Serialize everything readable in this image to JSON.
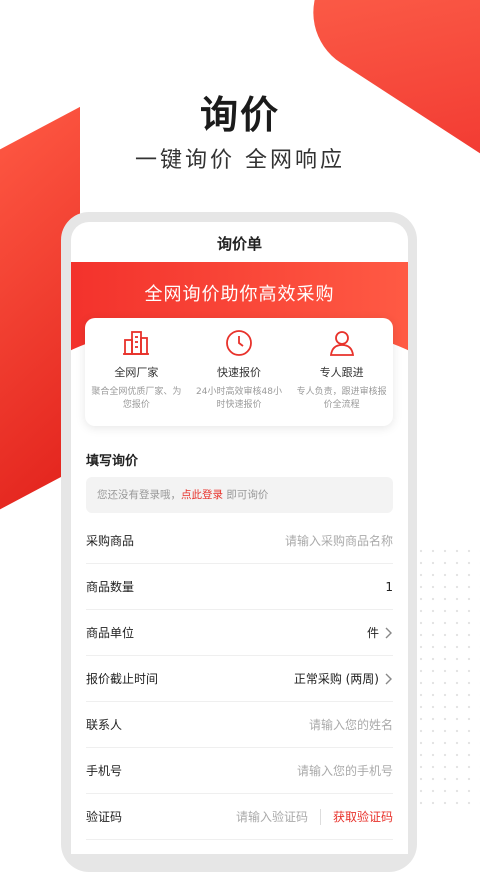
{
  "hero": {
    "title": "询价",
    "subtitle": "一键询价 全网响应"
  },
  "screen": {
    "title": "询价单",
    "banner": "全网询价助你高效采购",
    "features": [
      {
        "icon": "building-icon",
        "title": "全网厂家",
        "desc": "聚合全网优质厂家、为您报价"
      },
      {
        "icon": "clock-icon",
        "title": "快速报价",
        "desc": "24小时高效审核48小时快速报价"
      },
      {
        "icon": "person-icon",
        "title": "专人跟进",
        "desc": "专人负责，跟进审核报价全流程"
      }
    ],
    "section_title": "填写询价",
    "login_notice": {
      "before": "您还没有登录哦，",
      "link": "点此登录",
      "after": " 即可询价"
    },
    "form": {
      "product": {
        "label": "采购商品",
        "placeholder": "请输入采购商品名称"
      },
      "quantity": {
        "label": "商品数量",
        "value": "1"
      },
      "unit": {
        "label": "商品单位",
        "value": "件"
      },
      "deadline": {
        "label": "报价截止时间",
        "value": "正常采购 (两周)"
      },
      "contact": {
        "label": "联系人",
        "placeholder": "请输入您的姓名"
      },
      "phone": {
        "label": "手机号",
        "placeholder": "请输入您的手机号"
      },
      "code": {
        "label": "验证码",
        "placeholder": "请输入验证码",
        "button": "获取验证码"
      }
    }
  },
  "colors": {
    "accent": "#e8322b",
    "banner_start": "#f3322c",
    "banner_end": "#ff5a44"
  }
}
